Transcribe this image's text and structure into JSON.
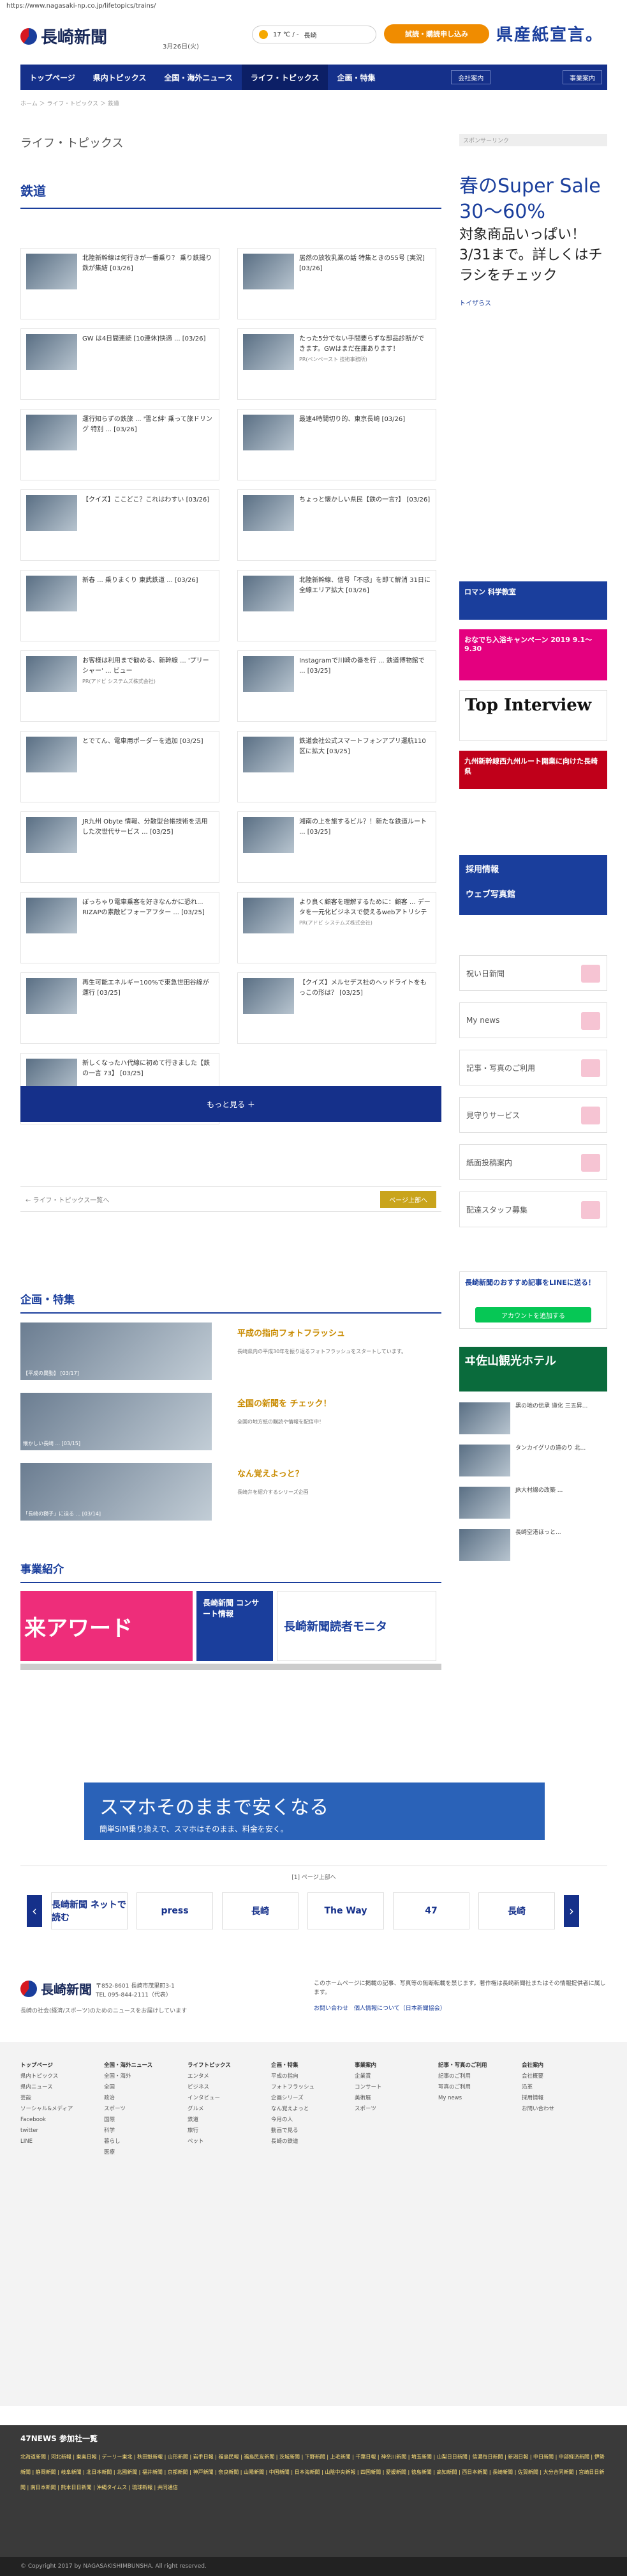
{
  "url": "https://www.nagasaki-np.co.jp/lifetopics/trains/",
  "header": {
    "logo_text": "長崎新聞",
    "date": "3月26日(火)",
    "weather_text": "17 ℃ / -",
    "weather_place": "長崎",
    "trial_button": "試読・購読申し込み",
    "promo_text": "県産紙宣言。"
  },
  "nav": {
    "items": [
      "トップページ",
      "県内トピックス",
      "全国・海外ニュース",
      "ライフ・トピックス",
      "企画・特集"
    ],
    "active": 3,
    "right_buttons": [
      "会社案内",
      "事業案内"
    ]
  },
  "breadcrumb": "ホーム ＞ ライフ・トピックス ＞ 鉄道",
  "page": {
    "section_title": "ライフ・トピックス",
    "subsection_title": "鉄道"
  },
  "articles": [
    {
      "title": "北陸新幹線は何行きが一番乗り？ 乗り鉄撮り鉄が集結 [03/26]",
      "pr": ""
    },
    {
      "title": "居然の放牧乳業の話 特集ときの55号 [実況] [03/26]",
      "pr": ""
    },
    {
      "title": "GW は4日間連続 [10連休]快適 ... [03/26]",
      "pr": ""
    },
    {
      "title": "たった5分でない手間要らずな部品診断ができます。GWはまだ在庫あります！",
      "pr": "PR(ペンペースト 技術事務所)"
    },
    {
      "title": "運行知らずの鉄旅 ... '雪と絆' 乗って旅ドリング 特別 ... [03/26]",
      "pr": ""
    },
    {
      "title": "最速4時間切り的、東京長崎 [03/26]",
      "pr": ""
    },
    {
      "title": "【クイズ】ここどこ？これはわすい [03/26]",
      "pr": ""
    },
    {
      "title": "ちょっと懐かしい県民【鉄の一言?】 [03/26]",
      "pr": ""
    },
    {
      "title": "新春 ... 乗りまくり 東武鉄道 ... [03/26]",
      "pr": ""
    },
    {
      "title": "北陸新幹線、信号「不感」を即て解消 31日に全線エリア拡大 [03/26]",
      "pr": ""
    },
    {
      "title": "お客様は利用まで勧める、新幹線 ... 'プリーシャー' ... ビュー",
      "pr": "PR(アドビ システムズ株式会社)"
    },
    {
      "title": "Instagramで川崎の番を行 ... 鉄道博物館で ... [03/25]",
      "pr": ""
    },
    {
      "title": "とでてん、電車用ポーダーを追加 [03/25]",
      "pr": ""
    },
    {
      "title": "鉄道会社公式スマートフォンアプリ運航110区に拡大 [03/25]",
      "pr": ""
    },
    {
      "title": "JR九州 Obyte 情報、分散型台帳技術を活用した次世代サービス ... [03/25]",
      "pr": ""
    },
    {
      "title": "湘南の上を旅するビル？！新たな鉄道ルート ... [03/25]",
      "pr": ""
    },
    {
      "title": "ぼっちゃり電車乗客を好きなんかに恐れ... RIZAPの素敵ビフォーアフター ... [03/25]",
      "pr": ""
    },
    {
      "title": "より良く顧客を理解するために：顧客 ... データを一元化ビジネスで使えるwebアトリシテ",
      "pr": "PR(アドビ システムズ株式会社)"
    },
    {
      "title": "再生可能エネルギー100%で東急世田谷線が運行 [03/25]",
      "pr": ""
    },
    {
      "title": "【クイズ】メルセデス社のヘッドライトをもっこの形は？ [03/25]",
      "pr": ""
    },
    {
      "title": "新しくなったハ代線に初めて行きました【鉄の一言 73】 [03/25]",
      "pr": ""
    }
  ],
  "more_button": "もっと見る ＋",
  "prev_link": "← ライフ・トピックス一覧へ",
  "next_button": "ページ上部へ",
  "kikaku": {
    "heading": "企画・特集",
    "items": [
      {
        "caption": "【平成の異動】 [03/17]",
        "title": "平成の指向フォトフラッシュ",
        "desc": "長崎県内の平成30年を振り返るフォトフラッシュをスタートしています。"
      },
      {
        "caption": "懐かしい長崎 ... [03/15]",
        "title": "全国の新聞を チェック！",
        "desc": "全国の地方紙の購読や情報を配信中！"
      },
      {
        "caption": "「長崎の獅子」に迫る ... [03/14]",
        "title": "なん覚えよっと？",
        "desc": "長崎弁を紹介するシリーズ企画"
      }
    ]
  },
  "jigyo": {
    "heading": "事業紹介",
    "slides": [
      "来アワード",
      "長崎新聞 コンサート情報",
      "長崎新聞読者モニタ"
    ]
  },
  "sidebar": {
    "sponsor_label": "スポンサーリンク",
    "ad_big": "春のSuper Sale 30〜60%",
    "ad_sub": "対象商品いっぱい！3/31まで。詳しくはチラシをチェック",
    "ad_brand": "トイザらス",
    "buttons": [
      "祝い日新聞",
      "My news",
      "記事・写真のご利用",
      "見守りサービス",
      "紙面投稿案内",
      "配達スタッフ募集"
    ],
    "recruit": "採用情報",
    "recruit_sub": "ウェブ写真館",
    "banners": [
      "ロマン 科学教室",
      "おなでち入浴キャンペーン 2019 9.1〜9.30",
      "Top Interview",
      "九州新幹線西九州ルート開業に向けた長崎県"
    ],
    "line_text": "長崎新聞のおすすめ記事をLINEに送る！",
    "line_button": "アカウントを追加する",
    "kanko": "ヰ佐山観光ホテル",
    "shots": [
      "黒の地の伝承 道化 三五昇...",
      "タンカイグリの道のり 北...",
      "JR大村線の改築 ...",
      "長崎空港ほっと..."
    ]
  },
  "big_ad": {
    "title": "スマホそのままで安くなる",
    "sub": "簡単SIM乗り換えで、スマホはそのまま、料金を安く。"
  },
  "carousel": {
    "label": "[1] ページ上部へ",
    "items": [
      "長崎新聞 ネットで読む",
      "press",
      "長崎",
      "The Way",
      "47",
      "長崎"
    ]
  },
  "footer": {
    "logo": "長崎新聞",
    "address": "〒852-8601 長崎市茂里町3-1",
    "tel": "TEL 095-844-2111（代表）",
    "slogan": "長崎の社会(経済/スポーツ)のためのニュースをお届けしています",
    "note": "このホームページに掲載の記事、写真等の無断転載を禁じます。著作権は長崎新聞社またはその情報提供者に属します。",
    "links": "お問い合わせ　個人情報について（日本新聞協会）"
  },
  "footer_cols": [
    {
      "head": "トップページ",
      "items": [
        "県内トピックス",
        "県内ニュース",
        "芸能",
        "ソーシャル&メディア",
        "Facebook",
        "twitter",
        "LINE"
      ]
    },
    {
      "head": "全国・海外ニュース",
      "items": [
        "全国・海外",
        "全国",
        "政治",
        "スポーツ",
        "国際",
        "科学",
        "暮らし",
        "医療"
      ]
    },
    {
      "head": "ライフトピックス",
      "items": [
        "エンタメ",
        "ビジネス",
        "インタビュー",
        "グルメ",
        "鉄道",
        "旅行",
        "ペット"
      ]
    },
    {
      "head": "企画・特集",
      "items": [
        "平成の指向",
        "フォトフラッシュ",
        "企画シリーズ",
        "なん覚えよっと",
        "今月の人",
        "動画で見る",
        "長崎の鉄道"
      ]
    },
    {
      "head": "事業案内",
      "items": [
        "企業賞",
        "コンサート",
        "美術展",
        "スポーツ"
      ]
    },
    {
      "head": "記事・写真のご利用",
      "items": [
        "記事のご利用",
        "写真のご利用",
        "My news"
      ]
    },
    {
      "head": "会社案内",
      "items": [
        "会社概要",
        "沿革",
        "採用情報",
        "お問い合わせ"
      ]
    }
  ],
  "network": {
    "heading": "47NEWS 参加社一覧",
    "links": "北海道新聞 | 河北新報 | 東奥日報 | デーリー東北 | 秋田魁新報 | 山形新聞 | 岩手日報 | 福島民報 | 福島民友新聞 | 茨城新聞 | 下野新聞 | 上毛新聞 | 千葉日報 | 神奈川新聞 | 埼玉新聞 | 山梨日日新聞 | 信濃毎日新聞 | 新潟日報 | 中日新聞 | 中部経済新聞 | 伊勢新聞 | 静岡新聞 | 岐阜新聞 | 北日本新聞 | 北國新聞 | 福井新聞 | 京都新聞 | 神戸新聞 | 奈良新聞 | 山陽新聞 | 中国新聞 | 日本海新聞 | 山陰中央新報 | 四国新聞 | 愛媛新聞 | 徳島新聞 | 高知新聞 | 西日本新聞 | 長崎新聞 | 佐賀新聞 | 大分合同新聞 | 宮崎日日新聞 | 南日本新聞 | 熊本日日新聞 | 沖縄タイムス | 琉球新報 | 共同通信"
  },
  "copyright": "© Copyright 2017 by NAGASAKISHIMBUNSHA. All right reserved."
}
